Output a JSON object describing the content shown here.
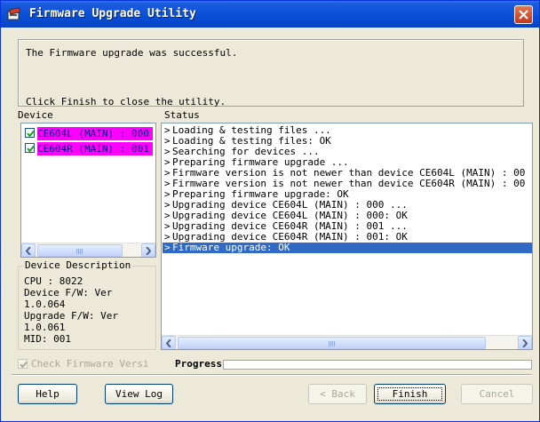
{
  "window": {
    "title": "Firmware Upgrade Utility",
    "icons": {
      "app": "app-icon",
      "close": "close-icon"
    },
    "colors": {
      "titlebar": "#0a4fd6",
      "selection": "#316ac5",
      "device_highlight": "#ff00ff",
      "progress": "#2ea3f2"
    }
  },
  "message": {
    "line1": "The Firmware upgrade was successful.",
    "line2": "Click Finish to close the utility."
  },
  "device": {
    "header": "Device",
    "items": [
      {
        "label": "CE604L (MAIN) : 000",
        "checked": true
      },
      {
        "label": "CE604R (MAIN) : 001",
        "checked": true
      }
    ],
    "description": {
      "title": "Device Description",
      "lines": [
        "CPU : 8022",
        "Device F/W: Ver",
        "1.0.064",
        "Upgrade F/W: Ver",
        "1.0.061",
        "MID: 001"
      ]
    }
  },
  "status": {
    "header": "Status",
    "lines": [
      "Loading & testing files ...",
      "Loading & testing files: OK",
      "Searching for devices ...",
      "Preparing firmware upgrade ...",
      "Firmware version is not newer than device CE604L (MAIN) : 00",
      "Firmware version is not newer than device CE604R (MAIN) : 00",
      "Preparing firmware upgrade: OK",
      "Upgrading device CE604L (MAIN) : 000 ...",
      "Upgrading device CE604L (MAIN) : 000: OK",
      "Upgrading device CE604R (MAIN) : 001 ...",
      "Upgrading device CE604R (MAIN) : 001: OK",
      "Firmware upgrade: OK"
    ],
    "selected_index": 11,
    "arrow": ">"
  },
  "footer": {
    "check_firmware_label": "Check Firmware Versi",
    "check_firmware_checked": true,
    "progress_label": "Progress.",
    "progress_fraction": 0.0
  },
  "buttons": {
    "help": "Help",
    "view_log": "View Log",
    "back": "< Back",
    "finish": "Finish",
    "cancel": "Cancel"
  }
}
